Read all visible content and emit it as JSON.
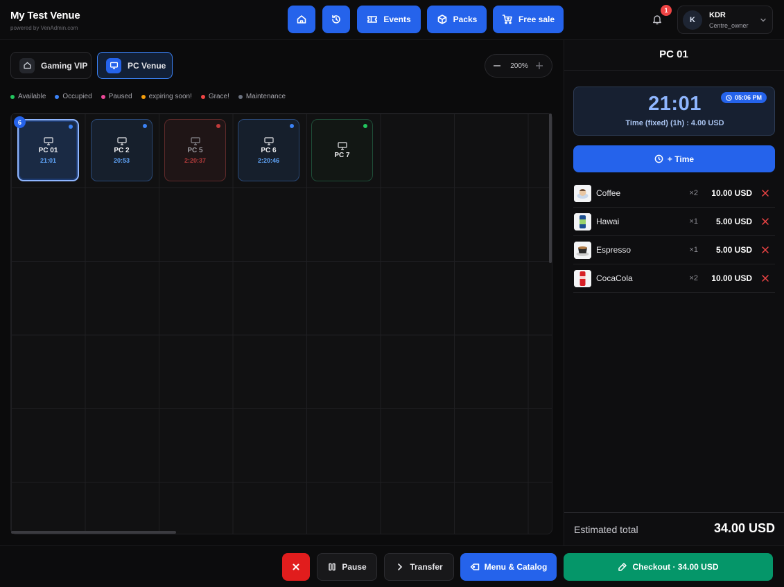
{
  "brand": {
    "title": "My Test Venue",
    "subtitle": "powered by VenAdmin.com"
  },
  "nav": {
    "home_icon": "home-icon",
    "history_icon": "history-icon",
    "events_label": "Events",
    "packs_label": "Packs",
    "free_sale_label": "Free sale"
  },
  "notifications": {
    "count": "1"
  },
  "user": {
    "initial": "K",
    "name": "KDR",
    "role": "Centre_owner"
  },
  "venues": [
    {
      "label": "Gaming VIP",
      "active": false
    },
    {
      "label": "PC Venue",
      "active": true
    }
  ],
  "zoom": {
    "value": "200%"
  },
  "legend": [
    {
      "label": "Available",
      "color": "#22c55e"
    },
    {
      "label": "Occupied",
      "color": "#3b82f6"
    },
    {
      "label": "Paused",
      "color": "#ec4899"
    },
    {
      "label": "expiring soon!",
      "color": "#f59e0b"
    },
    {
      "label": "Grace!",
      "color": "#ef4444"
    },
    {
      "label": "Maintenance",
      "color": "#6b7280"
    }
  ],
  "pc_count": "6",
  "stations": [
    {
      "name": "PC 01",
      "time": "21:01",
      "status": "occupied",
      "time_color": "#60a5fa",
      "dot_color": "#3b82f6"
    },
    {
      "name": "PC 2",
      "time": "20:53",
      "status": "occupied",
      "time_color": "#60a5fa",
      "dot_color": "#3b82f6"
    },
    {
      "name": "PC 5",
      "time": "2:20:37",
      "status": "paused",
      "time_color": "#b13b3b",
      "dot_color": "#c03a3a"
    },
    {
      "name": "PC 6",
      "time": "2:20:46",
      "status": "occupied",
      "time_color": "#60a5fa",
      "dot_color": "#3b82f6"
    },
    {
      "name": "PC 7",
      "time": "",
      "status": "available",
      "time_color": "#22c55e",
      "dot_color": "#22c55e"
    }
  ],
  "side": {
    "title": "PC 01",
    "timer": "21:01",
    "clock": "05:06 PM",
    "desc": "Time (fixed) (1h) : 4.00 USD",
    "add_time_label": "+ Time",
    "items": [
      {
        "name": "Coffee",
        "qty": "×2",
        "price": "10.00 USD"
      },
      {
        "name": "Hawai",
        "qty": "×1",
        "price": "5.00 USD"
      },
      {
        "name": "Espresso",
        "qty": "×1",
        "price": "5.00 USD"
      },
      {
        "name": "CocaCola",
        "qty": "×2",
        "price": "10.00 USD"
      }
    ],
    "total_label": "Estimated total",
    "total_value": "34.00 USD"
  },
  "actions": {
    "pause_label": "Pause",
    "transfer_label": "Transfer",
    "menu_label": "Menu & Catalog",
    "checkout_label": "Checkout · 34.00 USD"
  },
  "colors": {
    "accent": "#2563eb",
    "checkout": "#059669",
    "danger": "#e11d1d"
  }
}
